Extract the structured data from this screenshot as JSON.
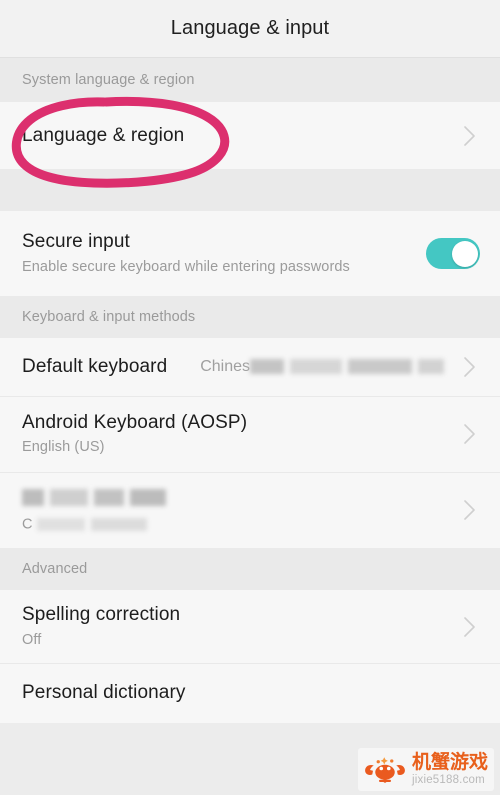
{
  "header": {
    "title": "Language & input"
  },
  "sections": [
    {
      "id": "system-language-region",
      "header": "System language & region",
      "rows": [
        {
          "id": "language-region",
          "title": "Language & region",
          "subtitle": "",
          "value": "",
          "control": "chevron",
          "redacted": false,
          "annotated": true
        }
      ]
    },
    {
      "id": "secure-input-group",
      "header": "",
      "rows": [
        {
          "id": "secure-input",
          "title": "Secure input",
          "subtitle": "Enable secure keyboard while entering passwords",
          "value": "",
          "control": "toggle",
          "toggle_on": true,
          "redacted": false,
          "annotated": false
        }
      ]
    },
    {
      "id": "keyboard-input-methods",
      "header": "Keyboard & input methods",
      "rows": [
        {
          "id": "default-keyboard",
          "title": "Default keyboard",
          "subtitle": "",
          "value": "Chines",
          "value_redacted": true,
          "control": "chevron",
          "redacted": false,
          "annotated": false
        },
        {
          "id": "android-keyboard-aosp",
          "title": "Android Keyboard (AOSP)",
          "subtitle": "English (US)",
          "value": "",
          "control": "chevron",
          "redacted": false,
          "annotated": false
        },
        {
          "id": "redacted-keyboard",
          "title": "",
          "subtitle": "C",
          "value": "",
          "control": "chevron",
          "redacted": true,
          "annotated": false
        }
      ]
    },
    {
      "id": "advanced",
      "header": "Advanced",
      "rows": [
        {
          "id": "spelling-correction",
          "title": "Spelling correction",
          "subtitle": "Off",
          "value": "",
          "control": "chevron",
          "redacted": false,
          "annotated": false
        },
        {
          "id": "personal-dictionary",
          "title": "Personal dictionary",
          "subtitle": "",
          "value": "",
          "control": "none",
          "redacted": false,
          "annotated": false
        }
      ]
    }
  ],
  "annotation": {
    "type": "hand-drawn-circle",
    "color": "#dc2f6e",
    "targets": "language-region"
  },
  "watermark": {
    "brand_cn": "机蟹游戏",
    "url": "jixie5188.com",
    "logo": "crab-icon",
    "color": "#e8601c"
  },
  "colors": {
    "page_background": "#ececec",
    "row_background": "#f7f7f7",
    "section_header_background": "#eaeaea",
    "title_bar_background": "#f2f2f2",
    "primary_text": "#1d1d1d",
    "secondary_text": "#9b9b9b",
    "toggle_on": "#44c7c3",
    "chevron": "#cfcfcf",
    "annotation_pink": "#dc2f6e"
  }
}
